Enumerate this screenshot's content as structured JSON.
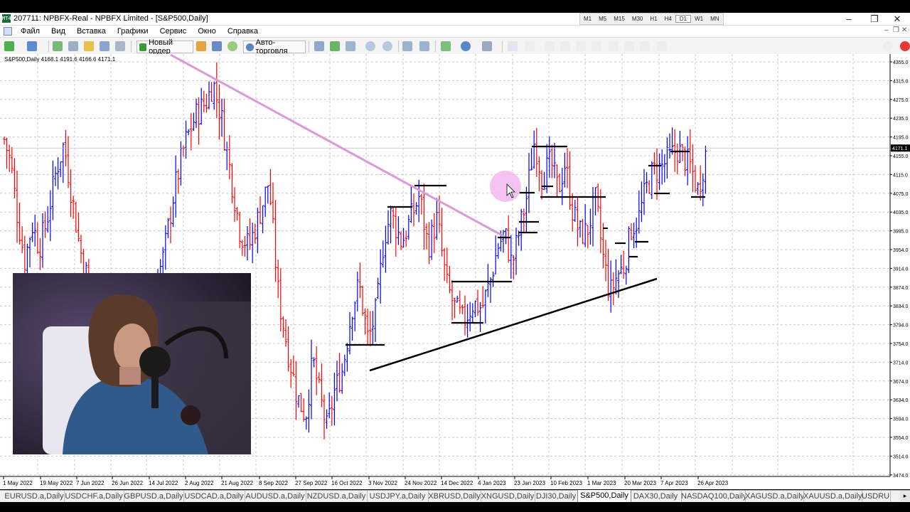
{
  "window": {
    "title": "207711: NPBFX-Real - NPBFX Limited - [S&P500,Daily]",
    "app_icon_text": "MT4"
  },
  "timeframes": [
    "M1",
    "M5",
    "M15",
    "M30",
    "H1",
    "H4",
    "D1",
    "W1",
    "MN"
  ],
  "active_timeframe": "D1",
  "menu": [
    "Файл",
    "Вид",
    "Вставка",
    "Графики",
    "Сервис",
    "Окно",
    "Справка"
  ],
  "toolbar": {
    "new_order": "Новый ордер",
    "auto_trading": "Авто-торговля"
  },
  "chart": {
    "symbol_label": "S&P500,Daily",
    "ohlc": "4168.1 4191.6 4166.6 4171.1",
    "current_price": "4171.1",
    "price_ticks": [
      "4355.0",
      "4315.0",
      "4275.0",
      "4235.0",
      "4195.0",
      "4155.0",
      "4115.0",
      "4075.0",
      "4035.0",
      "3995.0",
      "3954.0",
      "3914.0",
      "3874.0",
      "3834.0",
      "3794.0",
      "3754.0",
      "3714.0",
      "3674.0",
      "3634.0",
      "3594.0",
      "3554.0",
      "3514.0",
      "3474.0"
    ],
    "date_ticks": [
      "1 May 2022",
      "19 May 2022",
      "7 Jun 2022",
      "26 Jun 2022",
      "14 Jul 2022",
      "2 Aug 2022",
      "21 Aug 2022",
      "8 Sep 2022",
      "27 Sep 2022",
      "16 Oct 2022",
      "3 Nov 2022",
      "24 Nov 2022",
      "14 Dec 2022",
      "4 Jan 2023",
      "23 Jan 2023",
      "10 Feb 2023",
      "1 Mar 2023",
      "20 Mar 2023",
      "7 Apr 2023",
      "26 Apr 2023"
    ],
    "colors": {
      "bull": "#0000ff",
      "bear": "#ff0000",
      "grid": "#c8c8c8",
      "resistance_line": "#d99ad6",
      "support_line": "#000000",
      "cursor_highlight": "#f2b8ef"
    }
  },
  "tabs": [
    "EURUSD.a,Daily",
    "USDCHF.a,Daily",
    "GBPUSD.a,Daily",
    "USDCAD.a,Daily",
    "AUDUSD.a,Daily",
    "NZDUSD.a,Daily",
    "USDJPY.a,Daily",
    "XBRUSD,Daily",
    "XNGUSD,Daily",
    "DJI30,Daily",
    "S&P500,Daily",
    "DAX30,Daily",
    "NASDAQ100,Daily",
    "XAGUSD.a,Daily",
    "XAUUSD.a,Daily",
    "USDRUB"
  ],
  "active_tab": "S&P500,Daily"
}
